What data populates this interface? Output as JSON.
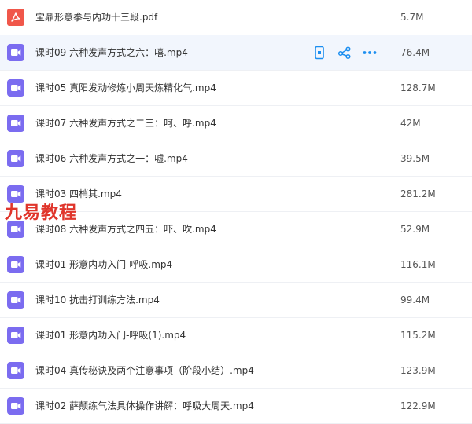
{
  "files": [
    {
      "name": "宝鼎形意拳与内功十三段.pdf",
      "size": "5.7M",
      "icon": "pdf-icon"
    },
    {
      "name": "课时09 六种发声方式之六：嘻.mp4",
      "size": "76.4M",
      "icon": "video-icon",
      "hovered": true
    },
    {
      "name": "课时05 真阳发动修炼小周天炼精化气.mp4",
      "size": "128.7M",
      "icon": "video-icon"
    },
    {
      "name": "课时07 六种发声方式之二三：呵、呼.mp4",
      "size": "42M",
      "icon": "video-icon"
    },
    {
      "name": "课时06 六种发声方式之一：嘘.mp4",
      "size": "39.5M",
      "icon": "video-icon"
    },
    {
      "name": "课时03 四梢其.mp4",
      "size": "281.2M",
      "icon": "video-icon"
    },
    {
      "name": "课时08 六种发声方式之四五：吓、吹.mp4",
      "size": "52.9M",
      "icon": "video-icon"
    },
    {
      "name": "课时01 形意内功入门-呼吸.mp4",
      "size": "116.1M",
      "icon": "video-icon"
    },
    {
      "name": "课时10 抗击打训练方法.mp4",
      "size": "99.4M",
      "icon": "video-icon"
    },
    {
      "name": "课时01 形意内功入门-呼吸(1).mp4",
      "size": "115.2M",
      "icon": "video-icon"
    },
    {
      "name": "课时04 真传秘诀及两个注意事项（阶段小结）.mp4",
      "size": "123.9M",
      "icon": "video-icon"
    },
    {
      "name": "课时02 薛颠练气法具体操作讲解：呼吸大周天.mp4",
      "size": "122.9M",
      "icon": "video-icon"
    }
  ],
  "row_actions": [
    "phone-icon",
    "share-icon",
    "more-icon"
  ],
  "watermark": "九易教程",
  "colors": {
    "video": "#7b6cf0",
    "pdf": "#f0574a",
    "accent": "#1b8ef0",
    "hover_bg": "#f2f6fd"
  }
}
